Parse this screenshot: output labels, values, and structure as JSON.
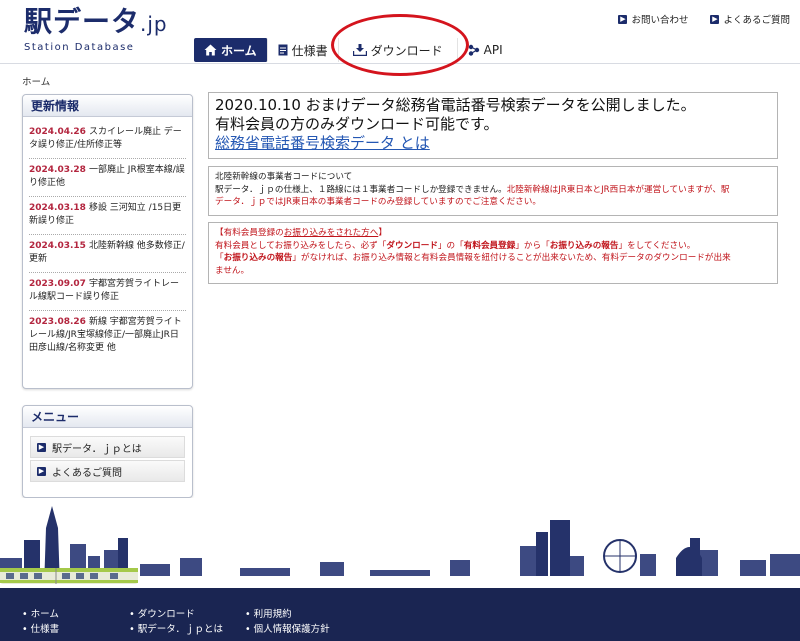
{
  "header": {
    "logo_main": "駅データ",
    "logo_suffix": ".jp",
    "logo_sub": "Station Database",
    "util_links": [
      "お問い合わせ",
      "よくあるご質問"
    ]
  },
  "nav": {
    "home": "ホーム",
    "spec": "仕様書",
    "download": "ダウンロード",
    "api": "API"
  },
  "breadcrumb": "ホーム",
  "news": {
    "title": "更新情報",
    "items": [
      {
        "date": "2024.04.26",
        "text": "スカイレール廃止 データ誤り修正/住所修正等"
      },
      {
        "date": "2024.03.28",
        "text": "一部廃止 JR根室本線/誤り修正他"
      },
      {
        "date": "2024.03.18",
        "text": "移設 三河知立 /15日更新誤り修正"
      },
      {
        "date": "2024.03.15",
        "text": "北陸新幹線 他多数修正/更新"
      },
      {
        "date": "2023.09.07",
        "text": "宇都宮芳賀ライトレール線駅コード誤り修正"
      },
      {
        "date": "2023.08.26",
        "text": "新線 宇都宮芳賀ライトレール線/JR宝塚線修正/一部廃止JR日田彦山線/名称変更 他"
      }
    ]
  },
  "menu": {
    "title": "メニュー",
    "items": [
      "駅データ．ｊｐとは",
      "よくあるご質問"
    ]
  },
  "notice": {
    "line1": "2020.10.10 おまけデータ総務省電話番号検索データを公開しました。",
    "line2": "有料会員の方のみダウンロード可能です。",
    "link": "総務省電話番号検索データ とは"
  },
  "box1": {
    "title": "北陸新幹線の事業者コードについて",
    "text_black": "駅データ．ｊｐの仕様上、１路線には１事業者コードしか登録できません。",
    "text_red_1": "北陸新幹線はJR東日本とJR西日本が運営していますが、駅",
    "text_red_2": "データ．ｊｐではJR東日本の事業者コードのみ登録していますのでご注意ください。"
  },
  "box2": {
    "title_prefix": "【有料会員登録の",
    "title_link": "お振り込みをされた方へ",
    "title_suffix": "】",
    "l1_a": "有料会員としてお振り込みをしたら、必ず「",
    "l1_b": "ダウンロード",
    "l1_c": "」の「",
    "l1_d": "有料会員登録",
    "l1_e": "」から「",
    "l1_f": "お振り込みの報告",
    "l1_g": "」をしてください。",
    "l2_a": "「",
    "l2_b": "お振り込みの報告",
    "l2_c": "」がなければ、お振り込み情報と有料会員情報を紐付けることが出来ないため、有料データのダウンロードが出来",
    "l3": "ません。"
  },
  "footer": {
    "col1": [
      "ホーム",
      "仕様書"
    ],
    "col2": [
      "ダウンロード",
      "駅データ．ｊｐとは"
    ],
    "col3": [
      "利用規約",
      "個人情報保護方針"
    ]
  },
  "colors": {
    "brand": "#1c2c6b",
    "date": "#b3263f",
    "alert": "#c0141b",
    "link": "#2457b3",
    "highlight": "#d4141d"
  }
}
